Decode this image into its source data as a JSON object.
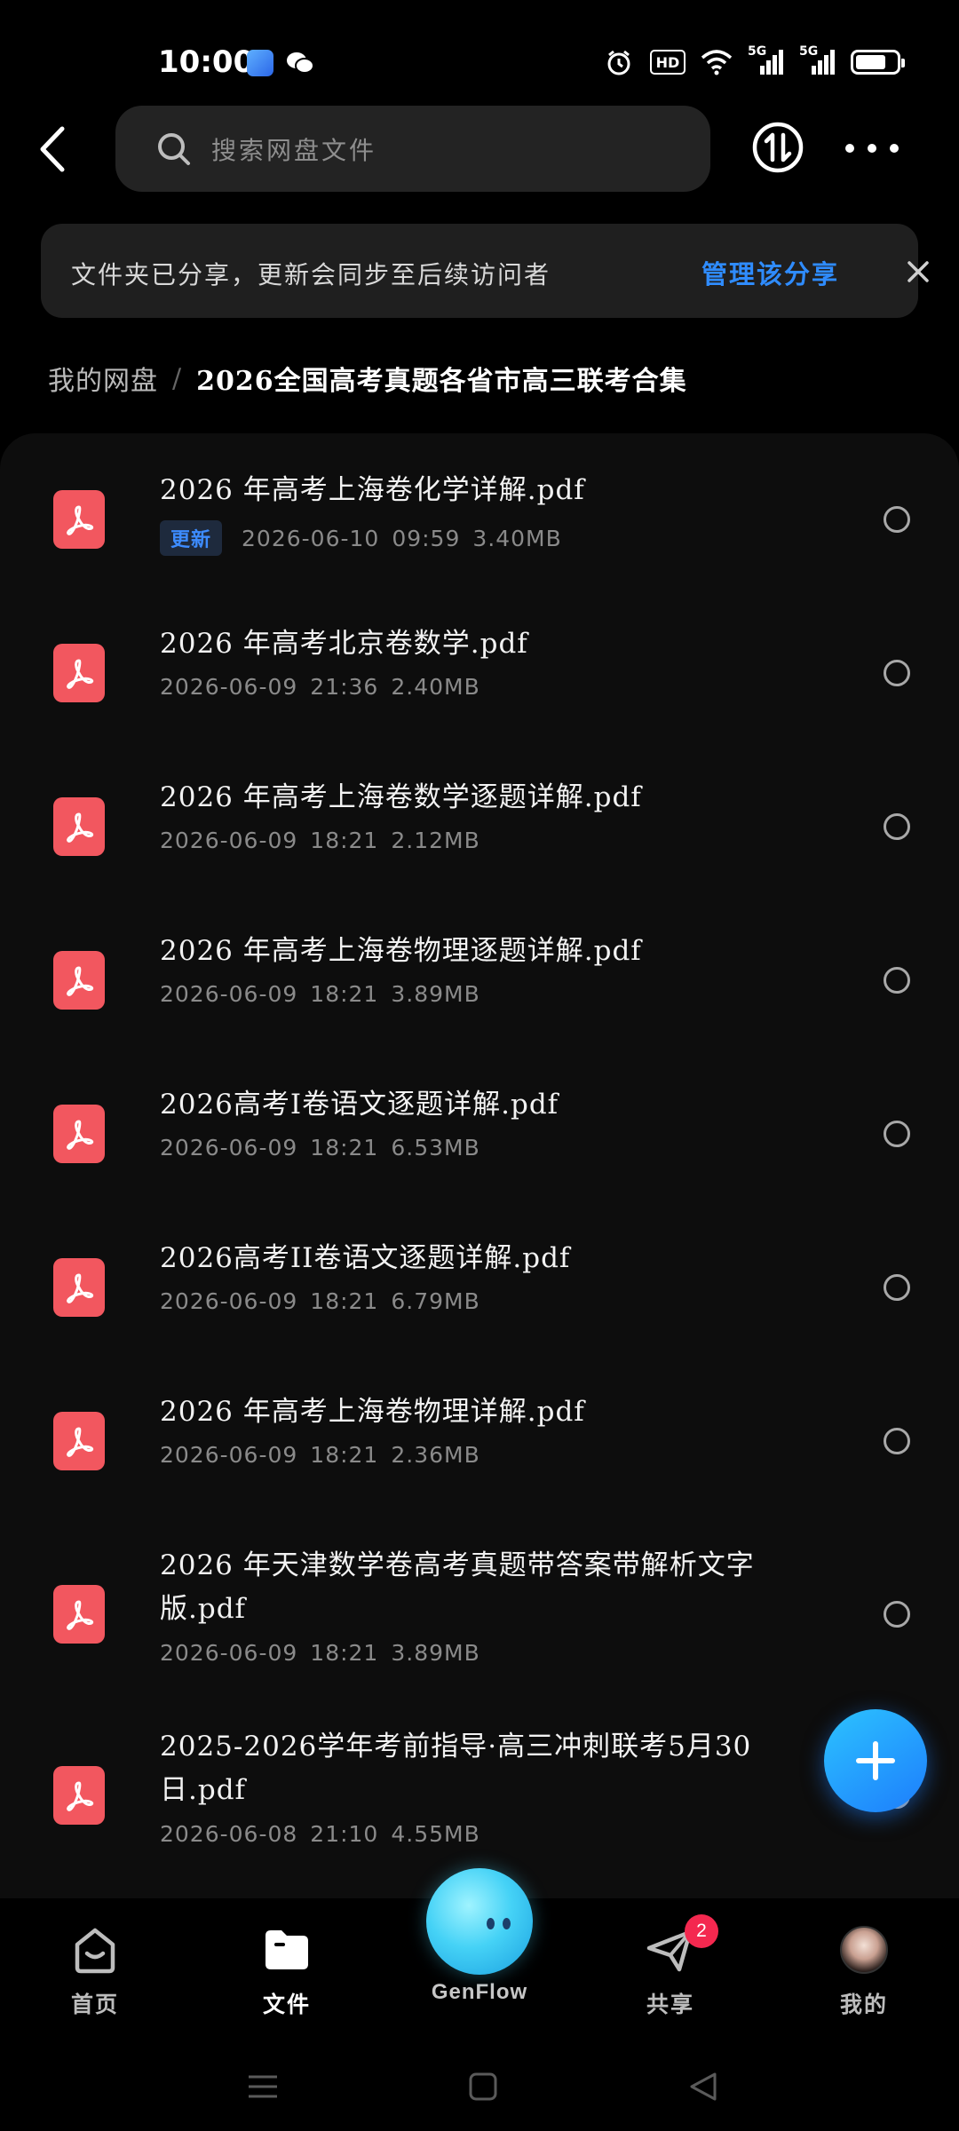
{
  "status_bar": {
    "time": "10:00",
    "left_app_icons": [
      "gallery-app-icon",
      "wechat-icon"
    ],
    "right_icons": [
      "alarm-icon",
      "hd-icon",
      "wifi-icon",
      "signal-5g-icon",
      "signal-5g-icon",
      "battery-icon"
    ],
    "hd_label": "HD",
    "net1": "5G",
    "net2": "5G",
    "battery_level": 0.75
  },
  "header": {
    "search_placeholder": "搜索网盘文件"
  },
  "notice": {
    "text": "文件夹已分享，更新会同步至后续访问者",
    "link_label": "管理该分享"
  },
  "breadcrumb": {
    "root": "我的网盘",
    "separator": "/",
    "current": "2026全国高考真题各省市高三联考合集"
  },
  "files": [
    {
      "name": "2026 年高考上海卷化学详解.pdf",
      "badge": "更新",
      "date": "2026-06-10",
      "time": "09:59",
      "size": "3.40MB"
    },
    {
      "name": "2026 年高考北京卷数学.pdf",
      "badge": "",
      "date": "2026-06-09",
      "time": "21:36",
      "size": "2.40MB"
    },
    {
      "name": "2026 年高考上海卷数学逐题详解.pdf",
      "badge": "",
      "date": "2026-06-09",
      "time": "18:21",
      "size": "2.12MB"
    },
    {
      "name": "2026 年高考上海卷物理逐题详解.pdf",
      "badge": "",
      "date": "2026-06-09",
      "time": "18:21",
      "size": "3.89MB"
    },
    {
      "name": "2026高考I卷语文逐题详解.pdf",
      "badge": "",
      "date": "2026-06-09",
      "time": "18:21",
      "size": "6.53MB"
    },
    {
      "name": "2026高考II卷语文逐题详解.pdf",
      "badge": "",
      "date": "2026-06-09",
      "time": "18:21",
      "size": "6.79MB"
    },
    {
      "name": "2026 年高考上海卷物理详解.pdf",
      "badge": "",
      "date": "2026-06-09",
      "time": "18:21",
      "size": "2.36MB"
    },
    {
      "name": "2026 年天津数学卷高考真题带答案带解析文字版.pdf",
      "badge": "",
      "date": "2026-06-09",
      "time": "18:21",
      "size": "3.89MB"
    },
    {
      "name": "2025-2026学年考前指导·高三冲刺联考5月30日.pdf",
      "badge": "",
      "date": "2026-06-08",
      "time": "21:10",
      "size": "4.55MB"
    }
  ],
  "bottom_nav": {
    "home": "首页",
    "files": "文件",
    "genflow": "GenFlow",
    "share": "共享",
    "share_badge": "2",
    "me": "我的"
  },
  "colors": {
    "accent": "#2f8cff",
    "pdf_red": "#f2575f",
    "badge_red": "#f4284f"
  }
}
